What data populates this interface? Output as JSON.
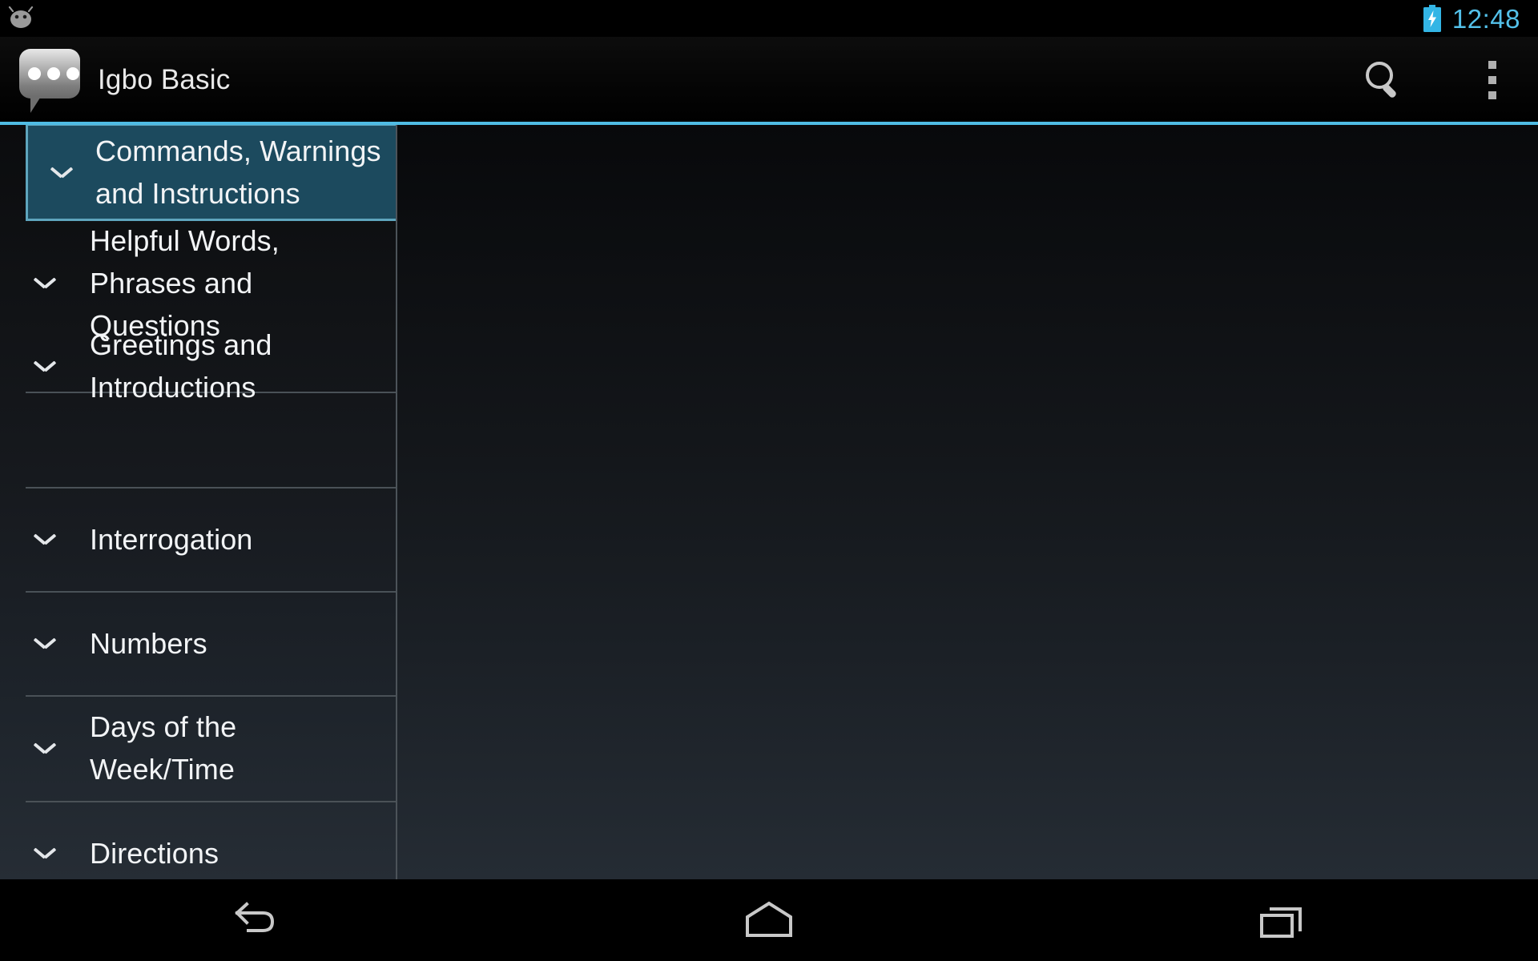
{
  "status_bar": {
    "os_icon": "android-bean-icon",
    "battery_icon": "battery-charging-icon",
    "clock": "12:48",
    "clock_color": "#53c0e9"
  },
  "action_bar": {
    "app_icon": "speech-bubble-icon",
    "title": "Igbo Basic",
    "search_icon": "search-icon",
    "overflow_icon": "overflow-menu-icon",
    "accent_color": "#4fbce4"
  },
  "list": {
    "selected_index": 0,
    "selected_bg": "#1c4a5e",
    "selected_border": "#5ea5bd",
    "items": [
      {
        "label": "Commands, Warnings and Instructions",
        "expand_icon": "chevron-down-icon",
        "selected": true
      },
      {
        "label": "Helpful Words, Phrases and Questions",
        "expand_icon": "chevron-down-icon",
        "selected": false
      },
      {
        "label": "Greetings and Introductions",
        "expand_icon": "chevron-down-icon",
        "selected": false
      },
      {
        "label": "Interrogation",
        "expand_icon": "chevron-down-icon",
        "selected": false
      },
      {
        "label": "Numbers",
        "expand_icon": "chevron-down-icon",
        "selected": false
      },
      {
        "label": "Days of the Week/Time",
        "expand_icon": "chevron-down-icon",
        "selected": false
      },
      {
        "label": "Directions",
        "expand_icon": "chevron-down-icon",
        "selected": false
      }
    ]
  },
  "detail_pane": {
    "content": ""
  },
  "nav_bar": {
    "back": "back-icon",
    "home": "home-icon",
    "recents": "recents-icon"
  }
}
